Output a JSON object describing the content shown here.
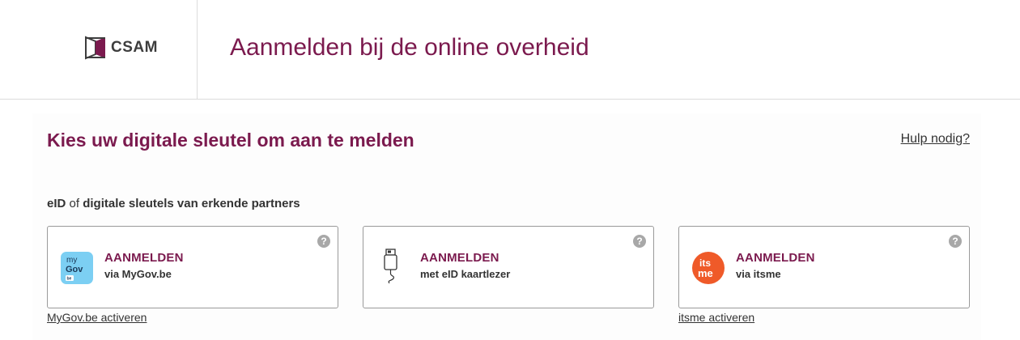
{
  "header": {
    "logo_text": "CSAM",
    "title": "Aanmelden bij de online overheid"
  },
  "main": {
    "title": "Kies uw digitale sleutel om aan te melden",
    "help_link": "Hulp nodig?",
    "subheading": {
      "part1": "eID",
      "part2": " of ",
      "part3": "digitale sleutels van erkende partners"
    },
    "cards": [
      {
        "label": "AANMELDEN",
        "sub": "via MyGov.be",
        "icon": "mygov-icon",
        "icon_text_1": "my",
        "icon_text_2": "Gov",
        "icon_text_3": "be",
        "help": "?"
      },
      {
        "label": "AANMELDEN",
        "sub": "met eID kaartlezer",
        "icon": "card-reader-icon",
        "help": "?"
      },
      {
        "label": "AANMELDEN",
        "sub": "via itsme",
        "icon": "itsme-icon",
        "icon_text_1": "its",
        "icon_text_2": "me",
        "help": "?"
      }
    ],
    "links": {
      "mygov_activate": "MyGov.be activeren",
      "itsme_activate": "itsme activeren"
    }
  },
  "colors": {
    "brand": "#7b1a4e",
    "mygov": "#7ccff3",
    "itsme": "#ef5a29"
  }
}
